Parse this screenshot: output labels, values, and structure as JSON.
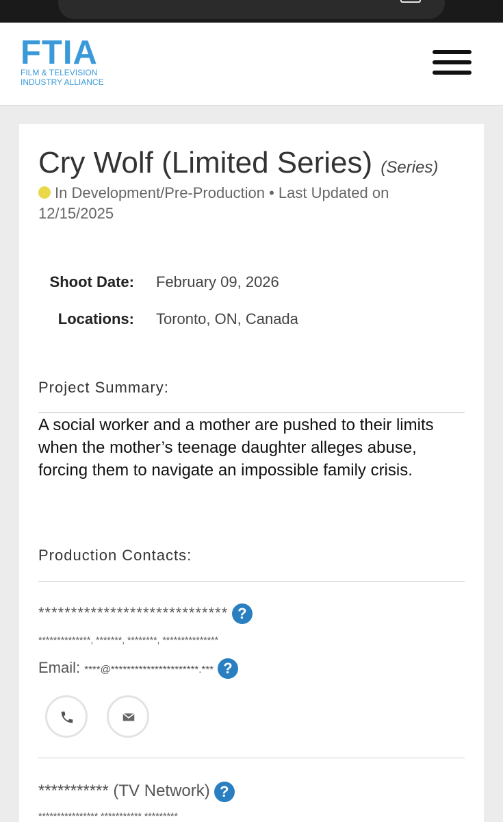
{
  "brand": {
    "logo_main": "FTIA",
    "logo_sub_line1": "FILM & TELEVISION",
    "logo_sub_line2": "INDUSTRY ALLIANCE",
    "color": "#3a9ad9"
  },
  "project": {
    "title": "Cry Wolf (Limited Series)",
    "type": "(Series)",
    "status": "In Development/Pre-Production",
    "status_color": "#e8d84a",
    "updated_text": "• Last Updated on",
    "updated_date": "12/15/2025"
  },
  "details": [
    {
      "label": "Shoot Date:",
      "value": "February 09, 2026"
    },
    {
      "label": "Locations:",
      "value": "Toronto, ON, Canada"
    }
  ],
  "summary": {
    "heading": "Project Summary:",
    "text": "A social worker and a mother are pushed to their limits when the mother’s teenage daughter alleges abuse, forcing them to navigate an impossible family crisis."
  },
  "contacts": {
    "heading": "Production Contacts:",
    "items": [
      {
        "name": "*****************************",
        "sub": "**************, *******, ********, ***************",
        "email_label": "Email:",
        "email_value": "****@**********************.***"
      },
      {
        "name": "*********** (TV Network)",
        "sub": "**************** *********** *********"
      }
    ]
  },
  "icons": {
    "help": "question-circle-icon",
    "phone": "phone-icon",
    "mail": "envelope-icon",
    "menu": "hamburger-menu-icon"
  },
  "help_glyph": "?"
}
